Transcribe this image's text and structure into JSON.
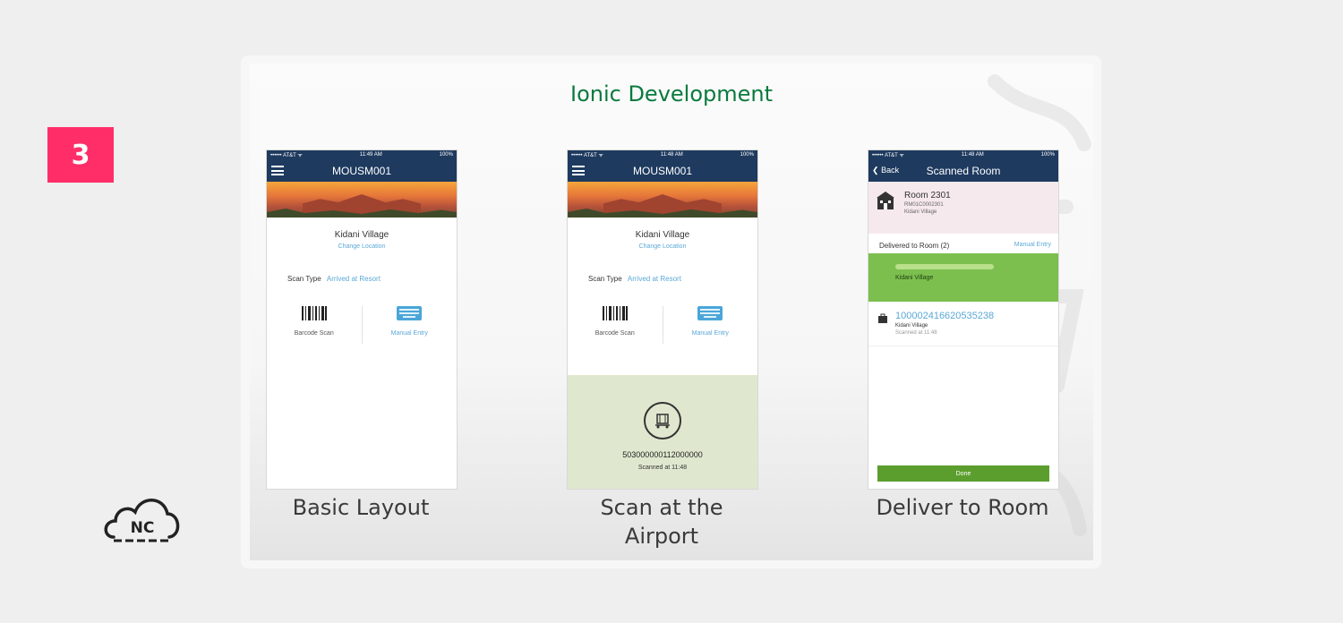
{
  "badge": "3",
  "logo": {
    "text": "NC"
  },
  "slide": {
    "title": "Ionic Development",
    "status": {
      "carrier": "•••••• AT&T ᯤ",
      "time1": "11:49 AM",
      "time2": "11:48 AM",
      "battery": "100%"
    },
    "phone1": {
      "nav_title": "MOUSM001",
      "location": "Kidani Village",
      "change_location": "Change Location",
      "scan_type_label": "Scan Type",
      "scan_type_value": "Arrived at Resort",
      "barcode_label": "Barcode Scan",
      "manual_label": "Manual Entry",
      "caption": "Basic Layout"
    },
    "phone2": {
      "nav_title": "MOUSM001",
      "location": "Kidani Village",
      "change_location": "Change Location",
      "scan_type_label": "Scan Type",
      "scan_type_value": "Arrived at Resort",
      "barcode_label": "Barcode Scan",
      "manual_label": "Manual Entry",
      "scan_code": "503000000112000000",
      "scan_time": "Scanned at 11:48",
      "caption_line1": "Scan at the",
      "caption_line2": "Airport"
    },
    "phone3": {
      "back_label": "Back",
      "nav_title": "Scanned Room",
      "room_title": "Room 2301",
      "room_code": "RM01C0002301",
      "room_location": "Kidani Village",
      "delivered_label": "Delivered to Room (2)",
      "manual_entry": "Manual Entry",
      "item1_location": "Kidani Village",
      "item2_code": "100002416620535238",
      "item2_location": "Kidani Village",
      "item2_time": "Scanned at 11:48",
      "done_label": "Done",
      "caption": "Deliver to Room"
    }
  }
}
